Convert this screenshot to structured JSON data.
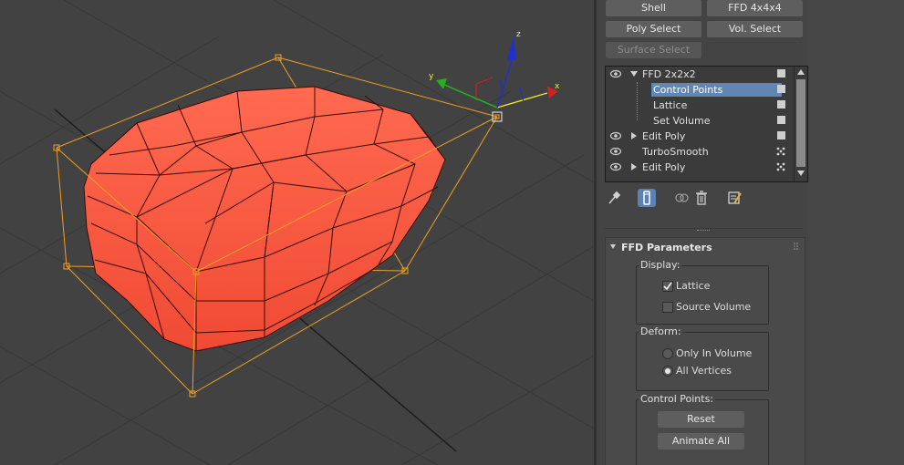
{
  "modifier_buttons": {
    "shell": "Shell",
    "ffd444": "FFD 4x4x4",
    "poly_select": "Poly Select",
    "vol_select": "Vol. Select",
    "surface_select": "Surface Select"
  },
  "stack": {
    "items": [
      {
        "label": "FFD 2x2x2",
        "expanded": true,
        "toggle": "checkbox"
      },
      {
        "label": "Control Points",
        "selected": true,
        "toggle": "checkbox"
      },
      {
        "label": "Lattice",
        "toggle": "checkbox"
      },
      {
        "label": "Set Volume",
        "toggle": "checkbox"
      },
      {
        "label": "Edit Poly",
        "expanded": false,
        "toggle": "checkbox"
      },
      {
        "label": "TurboSmooth",
        "toggle": "dots"
      },
      {
        "label": "Edit Poly",
        "expanded": false,
        "toggle": "dots"
      }
    ]
  },
  "rollout": {
    "title": "FFD Parameters",
    "display": {
      "label": "Display:",
      "lattice": {
        "label": "Lattice",
        "checked": true
      },
      "source_volume": {
        "label": "Source Volume",
        "checked": false
      }
    },
    "deform": {
      "label": "Deform:",
      "only_in_volume": {
        "label": "Only In Volume",
        "selected": false
      },
      "all_vertices": {
        "label": "All Vertices",
        "selected": true
      }
    },
    "control_points": {
      "label": "Control Points:",
      "reset": "Reset",
      "animate_all": "Animate All"
    }
  },
  "gizmo": {
    "x_label": "x",
    "y_label": "y",
    "z_label": "z"
  },
  "colors": {
    "object": "#ff5a40",
    "lattice": "#f0a020",
    "x_axis": "#d42020",
    "y_axis": "#20b020",
    "z_axis": "#2030d0",
    "selection": "#5f86b4"
  }
}
